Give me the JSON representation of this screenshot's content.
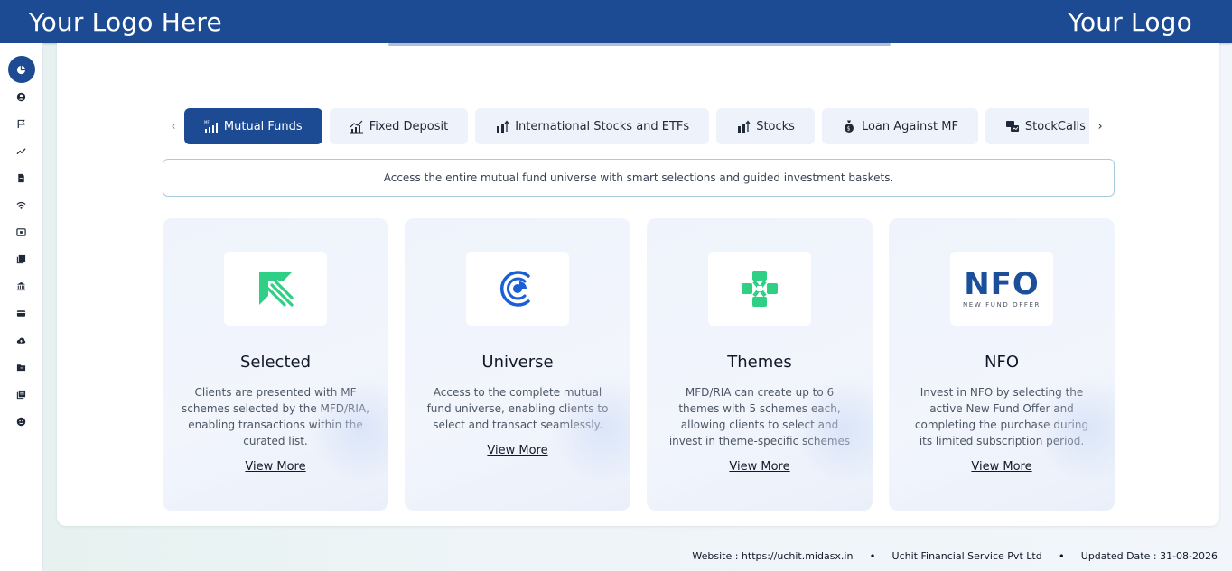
{
  "header": {
    "left_logo": "Your Logo Here",
    "right_logo": "Your Logo"
  },
  "sidebar": {
    "items": [
      {
        "icon": "pie-chart-icon",
        "active": true
      },
      {
        "icon": "user-icon"
      },
      {
        "icon": "flag-icon"
      },
      {
        "icon": "trend-line-icon"
      },
      {
        "icon": "document-icon"
      },
      {
        "icon": "wifi-icon"
      },
      {
        "icon": "id-card-icon"
      },
      {
        "icon": "book-icon"
      },
      {
        "icon": "bank-icon"
      },
      {
        "icon": "card-icon"
      },
      {
        "icon": "cloud-upload-icon"
      },
      {
        "icon": "folder-icon"
      },
      {
        "icon": "library-icon"
      },
      {
        "icon": "support-icon"
      }
    ]
  },
  "tabs": [
    {
      "label": "Mutual Funds",
      "icon": "mf-chart-icon",
      "active": true
    },
    {
      "label": "Fixed Deposit",
      "icon": "growth-chart-icon"
    },
    {
      "label": "International Stocks and ETFs",
      "icon": "bar-arrow-icon"
    },
    {
      "label": "Stocks",
      "icon": "bar-arrow-icon"
    },
    {
      "label": "Loan Against MF",
      "icon": "money-bag-icon"
    },
    {
      "label": "StockCalls",
      "icon": "stockcalls-icon"
    }
  ],
  "description": "Access the entire mutual fund universe with smart selections and guided investment baskets.",
  "cards": [
    {
      "title": "Selected",
      "text": "Clients are presented with MF schemes selected by the MFD/RIA, enabling transactions within the curated list.",
      "link": "View More"
    },
    {
      "title": "Universe",
      "text": "Access to the complete mutual fund universe, enabling clients to select and transact seamlessly.",
      "link": "View More"
    },
    {
      "title": "Themes",
      "text": "MFD/RIA can create up to 6 themes with 5 schemes each, allowing clients to select and invest in theme-specific schemes",
      "link": "View More"
    },
    {
      "title": "NFO",
      "text": "Invest in NFO by selecting the active New Fund Offer and completing the purchase during its limited subscription period.",
      "link": "View More",
      "logo_big": "NFO",
      "logo_small": "NEW FUND OFFER"
    }
  ],
  "footer": {
    "website": "Website : https://uchit.midasx.in",
    "company": "Uchit Financial Service Pvt Ltd",
    "updated": "Updated Date : 31-08-2026",
    "separator": "•"
  },
  "colors": {
    "brand": "#1d4b93",
    "green": "#2fcf86",
    "blue": "#1a5fd6"
  }
}
